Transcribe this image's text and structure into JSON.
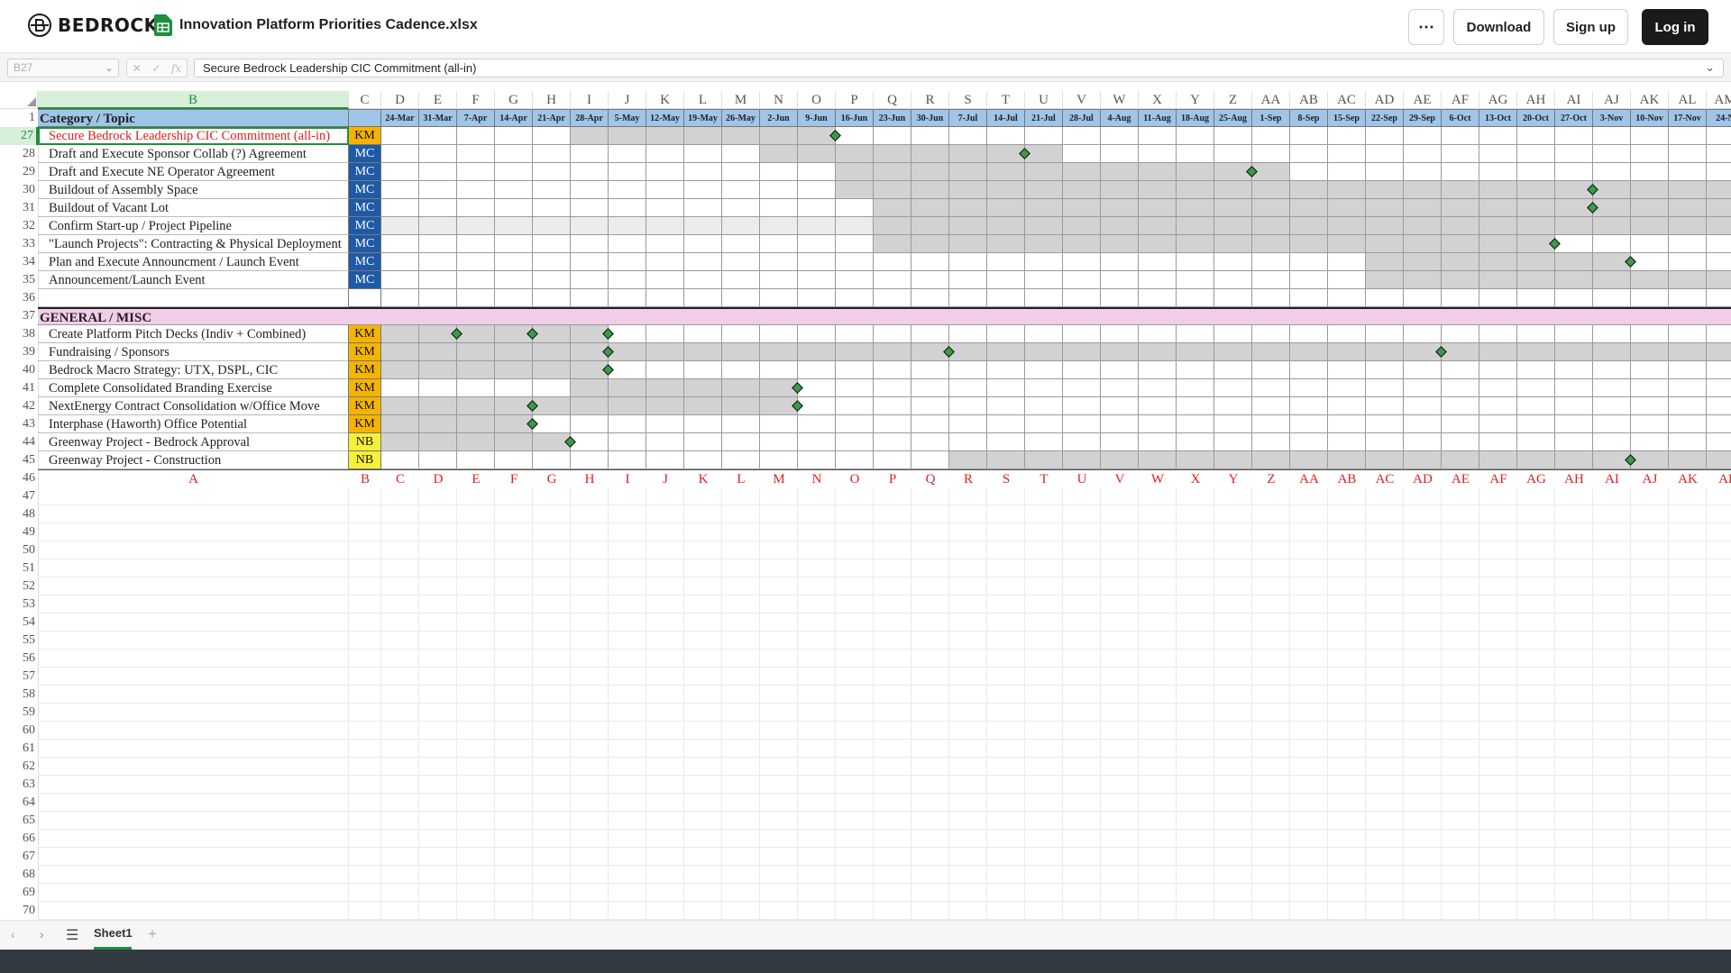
{
  "app": {
    "brand": "BEDROCK",
    "file_name": "Innovation Platform Priorities Cadence.xlsx",
    "more_icon": "more-horizontal-icon",
    "file_icon": "spreadsheet-file-icon"
  },
  "header_buttons": {
    "download": "Download",
    "signup": "Sign up",
    "login": "Log in"
  },
  "formula_bar": {
    "cell_ref": "B27",
    "content": "Secure Bedrock Leadership CIC Commitment (all-in)"
  },
  "columns": [
    "B",
    "C",
    "D",
    "E",
    "F",
    "G",
    "H",
    "I",
    "J",
    "K",
    "L",
    "M",
    "N",
    "O",
    "P",
    "Q",
    "R",
    "S",
    "T",
    "U",
    "V",
    "W",
    "X",
    "Y",
    "Z",
    "AA",
    "AB",
    "AC",
    "AD",
    "AE",
    "AF",
    "AG",
    "AH",
    "AI",
    "AJ",
    "AK",
    "AL",
    "AM"
  ],
  "weeks": [
    "24-Mar",
    "31-Mar",
    "7-Apr",
    "14-Apr",
    "21-Apr",
    "28-Apr",
    "5-May",
    "12-May",
    "19-May",
    "26-May",
    "2-Jun",
    "9-Jun",
    "16-Jun",
    "23-Jun",
    "30-Jun",
    "7-Jul",
    "14-Jul",
    "21-Jul",
    "28-Jul",
    "4-Aug",
    "11-Aug",
    "18-Aug",
    "25-Aug",
    "1-Sep",
    "8-Sep",
    "15-Sep",
    "22-Sep",
    "29-Sep",
    "6-Oct",
    "13-Oct",
    "20-Oct",
    "27-Oct",
    "3-Nov",
    "10-Nov",
    "17-Nov",
    "24-N"
  ],
  "header_row": {
    "num": "1",
    "label": "Category / Topic"
  },
  "tasks": [
    {
      "row": "27",
      "name": "Secure Bedrock Leadership CIC Commitment (all-in)",
      "owner": "KM",
      "bar": [
        5,
        11
      ],
      "bar_light": [],
      "milestones": [
        12
      ],
      "style": "selected"
    },
    {
      "row": "28",
      "name": "Draft and Execute Sponsor Collab (?) Agreement",
      "owner": "MC",
      "bar": [
        10,
        17
      ],
      "bar_light": [],
      "milestones": [
        17
      ]
    },
    {
      "row": "29",
      "name": "Draft and Execute NE Operator Agreement",
      "owner": "MC",
      "bar": [
        12,
        23
      ],
      "bar_light": [],
      "milestones": [
        23
      ]
    },
    {
      "row": "30",
      "name": "Buildout of Assembly Space",
      "owner": "MC",
      "bar": [
        12,
        35
      ],
      "bar_light": [],
      "milestones": [
        32
      ]
    },
    {
      "row": "31",
      "name": "Buildout of Vacant Lot",
      "owner": "MC",
      "bar": [
        13,
        35
      ],
      "bar_light": [],
      "milestones": [
        32
      ]
    },
    {
      "row": "32",
      "name": "Confirm Start-up / Project Pipeline",
      "owner": "MC",
      "bar": [
        13,
        35
      ],
      "bar_light": [
        0,
        12
      ],
      "milestones": []
    },
    {
      "row": "33",
      "name": "\"Launch Projects\":  Contracting & Physical Deployment",
      "owner": "MC",
      "bar": [
        13,
        30
      ],
      "bar_light": [],
      "milestones": [
        31
      ]
    },
    {
      "row": "34",
      "name": "Plan and Execute Announcment / Launch Event",
      "owner": "MC",
      "bar": [
        26,
        32
      ],
      "bar_light": [],
      "milestones": [
        33
      ]
    },
    {
      "row": "35",
      "name": "Announcement/Launch Event",
      "owner": "MC",
      "bar": [
        26,
        35
      ],
      "bar_light": [],
      "milestones": []
    },
    {
      "row": "36",
      "name": "",
      "owner": "",
      "bar": [],
      "bar_light": [],
      "milestones": []
    },
    {
      "row": "37",
      "name": "GENERAL / MISC",
      "owner": "",
      "bar": [],
      "bar_light": [],
      "milestones": [],
      "style": "section"
    },
    {
      "row": "38",
      "name": "Create Platform Pitch Decks (Indiv + Combined)",
      "owner": "KM",
      "bar": [
        0,
        5
      ],
      "bar_light": [],
      "milestones": [
        2,
        4,
        6
      ]
    },
    {
      "row": "39",
      "name": "Fundraising / Sponsors",
      "owner": "KM",
      "bar": [
        0,
        35
      ],
      "bar_light": [],
      "milestones": [
        6,
        15,
        28
      ]
    },
    {
      "row": "40",
      "name": "Bedrock Macro Strategy:  UTX, DSPL, CIC",
      "owner": "KM",
      "bar": [
        0,
        5
      ],
      "bar_light": [],
      "milestones": [
        6
      ]
    },
    {
      "row": "41",
      "name": "Complete Consolidated Branding Exercise",
      "owner": "KM",
      "bar": [
        5,
        10
      ],
      "bar_light": [],
      "milestones": [
        11
      ]
    },
    {
      "row": "42",
      "name": "NextEnergy  Contract Consolidation w/Office Move",
      "owner": "KM",
      "bar": [
        0,
        10
      ],
      "bar_light": [],
      "milestones": [
        4,
        11
      ]
    },
    {
      "row": "43",
      "name": "Interphase (Haworth) Office Potential",
      "owner": "KM",
      "bar": [
        0,
        3
      ],
      "bar_light": [],
      "milestones": [
        4
      ]
    },
    {
      "row": "44",
      "name": "Greenway Project - Bedrock Approval",
      "owner": "NB",
      "bar": [
        0,
        4
      ],
      "bar_light": [],
      "milestones": [
        5
      ]
    },
    {
      "row": "45",
      "name": "Greenway Project - Construction",
      "owner": "NB",
      "bar": [
        15,
        35
      ],
      "bar_light": [],
      "milestones": [
        33
      ]
    }
  ],
  "letter_row": {
    "row": "46",
    "a": "A",
    "b": "B",
    "letters": [
      "C",
      "D",
      "E",
      "F",
      "G",
      "H",
      "I",
      "J",
      "K",
      "L",
      "M",
      "N",
      "O",
      "P",
      "Q",
      "R",
      "S",
      "T",
      "U",
      "V",
      "W",
      "X",
      "Y",
      "Z",
      "AA",
      "AB",
      "AC",
      "AD",
      "AE",
      "AF",
      "AG",
      "AH",
      "AI",
      "AJ",
      "AK",
      "AI"
    ]
  },
  "empty_rows": [
    "47",
    "48",
    "49",
    "50",
    "51",
    "52",
    "53",
    "54",
    "55",
    "56",
    "57",
    "58",
    "59",
    "60",
    "61",
    "62",
    "63",
    "64",
    "65",
    "66",
    "67",
    "68",
    "69",
    "70"
  ],
  "sheet_tabs": [
    "Sheet1"
  ],
  "colors": {
    "km": "#f5b400",
    "mc": "#1f5aa6",
    "nb": "#f5f03a",
    "header_fill": "#9fc5e8",
    "section_fill": "#f1cde9",
    "bar": "#d2d2d2",
    "bar_light": "#ececec",
    "milestone": "#3a9a48",
    "selected_text": "#e02020",
    "letter_row_text": "#e02020"
  }
}
